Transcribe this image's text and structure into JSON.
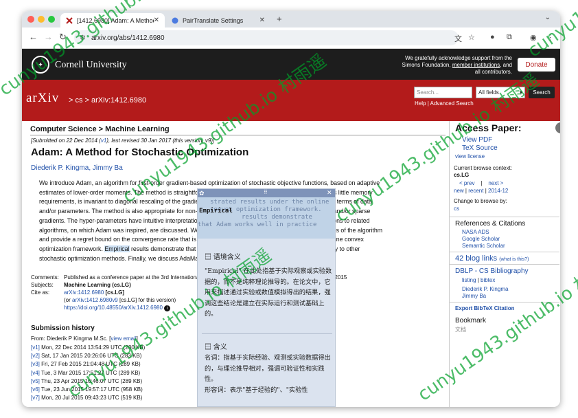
{
  "colors": {
    "arxiv_red": "#b31b1b",
    "cornell_black": "#1d1d1d",
    "link": "#1f4fa8",
    "watermark": "#00a028"
  },
  "tabs": [
    {
      "title": "[1412.6980] Adam: A Method for Stochastic Optimization",
      "icon": "arxiv-favicon"
    },
    {
      "title": "PairTranslate Settings",
      "icon": "pairtranslate-favicon"
    }
  ],
  "toolbar": {
    "url": "arxiv.org/abs/1412.6980"
  },
  "cornell": {
    "name": "Cornell University",
    "ack_line1": "We gratefully acknowledge support from the",
    "ack_line2": "Simons Foundation,",
    "ack_link": "member institutions",
    "ack_line2b": ", and",
    "ack_line3": "all contributors.",
    "donate": "Donate"
  },
  "arxiv": {
    "logo": "arXiv",
    "crumb": "> cs > arXiv:1412.6980",
    "search_placeholder": "Search...",
    "search_field": "All fields",
    "search_button": "Search",
    "help": "Help",
    "advanced": "Advanced Search",
    "sep": "|"
  },
  "paper": {
    "subject": "Computer Science > Machine Learning",
    "submitted_pre": "[Submitted on 22 Dec 2014 (",
    "submitted_v1": "v1",
    "submitted_post": "), last revised 30 Jan 2017 (this version, v9)]",
    "title": "Adam: A Method for Stochastic Optimization",
    "author1": "Diederik P. Kingma",
    "author_sep": ", ",
    "author2": "Jimmy Ba",
    "abstract_lines": [
      "We introduce Adam, an algorithm for first-order gradient-based optimization of stochastic objective functions, based on adaptive",
      "estimates of lower-order moments. The method is straightforward to implement, is computationally efficient, has little memory",
      "requirements, is invariant to diagonal rescaling of the gradients, and is well suited for problems that are large in terms of data",
      "and/or parameters. The method is also appropriate for non-stationary objectives and problems with very noisy and/or sparse",
      "gradients. The hyper-parameters have intuitive interpretations and typically require little tuning. Some connections to related",
      "algorithms, on which Adam was inspired, are discussed. We also analyze the theoretical convergence properties of the algorithm",
      "and provide a regret bound on the convergence rate that is comparable to the best known results under the online convex"
    ],
    "abstract_l8_pre": "optimization framework. ",
    "abstract_l8_hl": "Empirical",
    "abstract_l8_post": " results demonstrate that Adam works well in practice and compares favorably to other",
    "abstract_l9": "stochastic optimization methods. Finally, we discuss AdaMax, a variant of Adam based on the infinity norm.",
    "comments_label": "Comments:",
    "comments_value": "Published as a conference paper at the 3rd International Conference for Learning Representations, San Diego, 2015",
    "subjects_label": "Subjects:",
    "subjects_value": "Machine Learning (cs.LG)",
    "cite_label": "Cite as:",
    "cite_link": "arXiv:1412.6980",
    "cite_suffix": " [cs.LG]",
    "cite2_pre": "(or ",
    "cite2_link": "arXiv:1412.6980v9",
    "cite2_suffix": " [cs.LG] for this version)",
    "doi": "https://doi.org/10.48550/arXiv.1412.6980",
    "info_icon": "info-icon"
  },
  "history": {
    "title": "Submission history",
    "from_pre": "From: Diederik P Kingma M.Sc. [",
    "from_link": "view email",
    "from_post": "]",
    "versions": [
      {
        "v": "[v1]",
        "text": " Mon, 22 Dec 2014 13:54:29 UTC (280 KB)"
      },
      {
        "v": "[v2]",
        "text": " Sat, 17 Jan 2015 20:26:06 UTC (283 KB)"
      },
      {
        "v": "[v3]",
        "text": " Fri, 27 Feb 2015 21:04:48 UTC (289 KB)"
      },
      {
        "v": "[v4]",
        "text": " Tue, 3 Mar 2015 17:51:27 UTC (289 KB)"
      },
      {
        "v": "[v5]",
        "text": " Thu, 23 Apr 2015 16:46:07 UTC (289 KB)"
      },
      {
        "v": "[v6]",
        "text": " Tue, 23 Jun 2015 19:57:17 UTC (958 KB)"
      },
      {
        "v": "[v7]",
        "text": " Mon, 20 Jul 2015 09:43:23 UTC (519 KB)"
      }
    ]
  },
  "sidebar": {
    "access_title": "Access Paper:",
    "view_pdf": "View PDF",
    "tex_source": "TeX Source",
    "view_license": "view license",
    "context_label": "Current browse context:",
    "context_value": "cs.LG",
    "prev": "< prev",
    "next": "next >",
    "pipe": "|",
    "new": "new",
    "recent": "recent",
    "date": "2014-12",
    "change_label": "Change to browse by:",
    "change_value": "cs",
    "refs_title": "References & Citations",
    "nasa": "NASA ADS",
    "scholar": "Google Scholar",
    "semantic": "Semantic Scholar",
    "blog_pre": "42 blog links",
    "blog_what": "(what is this?)",
    "dblp_title": "DBLP - CS Bibliography",
    "listing": "listing",
    "bibtex": "bibtex",
    "dblp_author1": "Diederik P. Kingma",
    "dblp_author2": "Jimmy Ba",
    "export": "Export BibTeX Citation",
    "bookmark": "Bookmark",
    "bookmark_sub": "文档"
  },
  "popup": {
    "src_line1": "strated results under the online",
    "src_line2": "convex optimization framework.",
    "src_word": "Empirical",
    "src_line3": "results demonstrate",
    "src_line4": "that Adam works well in practice",
    "section1": "语境含义",
    "body1": "\"Empirical\" 在此处指基于实际观察或实验数据的，而不是纯粹理论推导的。在论文中，它用来描述通过实验或数值模拟得出的结果，强调这些结论是建立在实际运行和测试基础上的。",
    "section2": "含义",
    "body2": "名词：指基于实际经验、观测或实验数据得出的，与理论推导相对，强调可验证性和实践性。",
    "body3": "形容词：表示\"基于经验的\"、\"实验性"
  },
  "watermark": "cunyu1943.github.io 村雨遥"
}
